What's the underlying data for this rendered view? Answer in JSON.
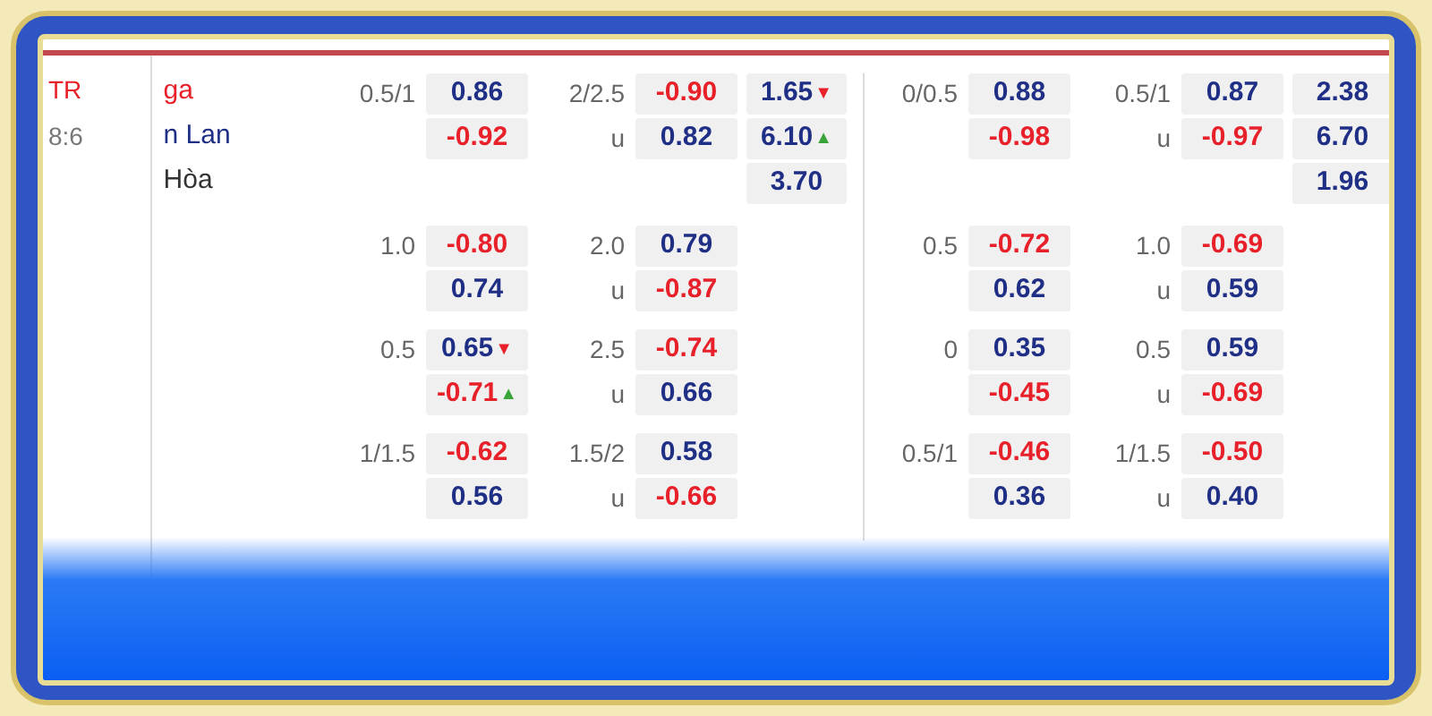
{
  "match": {
    "league": "TR",
    "time": "8:6",
    "teams": [
      {
        "name": "ga",
        "color": "#e8202a"
      },
      {
        "name": "n Lan",
        "color": "#1f2f86"
      }
    ],
    "draw": "Hòa"
  },
  "rows": [
    {
      "full_time": {
        "handicap": [
          {
            "label": "0.5/1",
            "odd": "0.86",
            "color": "#1f2f86"
          },
          {
            "odd": "-0.92",
            "color": "#e8202a"
          }
        ],
        "over_under": [
          {
            "label": "2/2.5",
            "odd": "-0.90",
            "color": "#e8202a"
          },
          {
            "label": "u",
            "odd": "0.82",
            "color": "#1f2f86"
          }
        ],
        "one_x_two": [
          {
            "odd": "1.65",
            "color": "#1f2f86",
            "arrow": "▼",
            "rising": false
          },
          {
            "odd": "6.10",
            "color": "#1f2f86",
            "arrow": "▲",
            "rising": true
          },
          {
            "odd": "3.70",
            "color": "#1f2f86"
          }
        ]
      },
      "first_half": {
        "handicap": [
          {
            "label": "0/0.5",
            "odd": "0.88",
            "color": "#1f2f86"
          },
          {
            "odd": "-0.98",
            "color": "#e8202a"
          }
        ],
        "over_under": [
          {
            "label": "0.5/1",
            "odd": "0.87",
            "color": "#1f2f86"
          },
          {
            "label": "u",
            "odd": "-0.97",
            "color": "#e8202a"
          }
        ],
        "one_x_two": [
          {
            "odd": "2.38",
            "color": "#1f2f86"
          },
          {
            "odd": "6.70",
            "color": "#1f2f86"
          },
          {
            "odd": "1.96",
            "color": "#1f2f86"
          }
        ]
      }
    },
    {
      "full_time": {
        "handicap": [
          {
            "label": "1.0",
            "odd": "-0.80",
            "color": "#e8202a"
          },
          {
            "odd": "0.74",
            "color": "#1f2f86"
          }
        ],
        "over_under": [
          {
            "label": "2.0",
            "odd": "0.79",
            "color": "#1f2f86"
          },
          {
            "label": "u",
            "odd": "-0.87",
            "color": "#e8202a"
          }
        ]
      },
      "first_half": {
        "handicap": [
          {
            "label": "0.5",
            "odd": "-0.72",
            "color": "#e8202a"
          },
          {
            "odd": "0.62",
            "color": "#1f2f86"
          }
        ],
        "over_under": [
          {
            "label": "1.0",
            "odd": "-0.69",
            "color": "#e8202a"
          },
          {
            "label": "u",
            "odd": "0.59",
            "color": "#1f2f86"
          }
        ]
      }
    },
    {
      "full_time": {
        "handicap": [
          {
            "label": "0.5",
            "odd": "0.65",
            "color": "#1f2f86",
            "arrow": "▼",
            "rising": false
          },
          {
            "odd": "-0.71",
            "color": "#e8202a",
            "arrow": "▲",
            "rising": true
          }
        ],
        "over_under": [
          {
            "label": "2.5",
            "odd": "-0.74",
            "color": "#e8202a"
          },
          {
            "label": "u",
            "odd": "0.66",
            "color": "#1f2f86"
          }
        ]
      },
      "first_half": {
        "handicap": [
          {
            "label": "0",
            "odd": "0.35",
            "color": "#1f2f86"
          },
          {
            "odd": "-0.45",
            "color": "#e8202a"
          }
        ],
        "over_under": [
          {
            "label": "0.5",
            "odd": "0.59",
            "color": "#1f2f86"
          },
          {
            "label": "u",
            "odd": "-0.69",
            "color": "#e8202a"
          }
        ]
      }
    },
    {
      "full_time": {
        "handicap": [
          {
            "label": "1/1.5",
            "odd": "-0.62",
            "color": "#e8202a"
          },
          {
            "odd": "0.56",
            "color": "#1f2f86"
          }
        ],
        "over_under": [
          {
            "label": "1.5/2",
            "odd": "0.58",
            "color": "#1f2f86"
          },
          {
            "label": "u",
            "odd": "-0.66",
            "color": "#e8202a"
          }
        ]
      },
      "first_half": {
        "handicap": [
          {
            "label": "0.5/1",
            "odd": "-0.46",
            "color": "#e8202a"
          },
          {
            "odd": "0.36",
            "color": "#1f2f86"
          }
        ],
        "over_under": [
          {
            "label": "1/1.5",
            "odd": "-0.50",
            "color": "#e8202a"
          },
          {
            "label": "u",
            "odd": "0.40",
            "color": "#1f2f86"
          }
        ]
      }
    }
  ]
}
